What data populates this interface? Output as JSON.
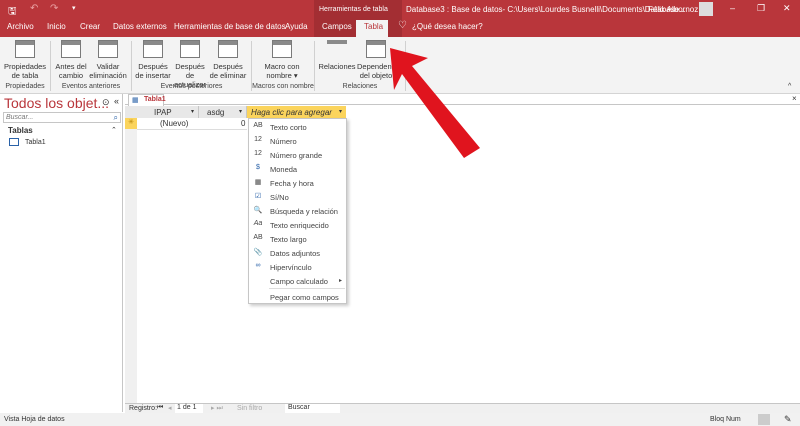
{
  "qat": {
    "save": "save-icon",
    "undo": "undo-icon",
    "redo": "redo-icon"
  },
  "title": {
    "context": "Herramientas de tabla",
    "doc": "Database3 : Base de datos- C:\\Users\\Lourdes Busnelli\\Documents\\Database...",
    "user": "Félix Albornoz"
  },
  "tabs": [
    "Archivo",
    "Inicio",
    "Crear",
    "Datos externos",
    "Herramientas de base de datos",
    "Ayuda",
    "Campos",
    "Tabla"
  ],
  "tellme": "¿Qué desea hacer?",
  "ribbon": {
    "buttons": [
      "Propiedades de tabla",
      "Antes del cambio",
      "Validar eliminación",
      "Después de insertar",
      "Después de actualizar",
      "Después de eliminar",
      "Macro con nombre ▾",
      "Relaciones",
      "Dependencias del objeto"
    ],
    "groups": [
      "Propiedades",
      "Eventos anteriores",
      "Eventos posteriores",
      "Macros con nombre",
      "Relaciones"
    ]
  },
  "nav": {
    "title": "Todos los objet...",
    "search_placeholder": "Buscar...",
    "section": "Tablas",
    "items": [
      "Tabla1"
    ]
  },
  "doc_tab": "Tabla1",
  "table": {
    "columns": [
      "IPAP",
      "asdg",
      "Haga clic para agregar"
    ],
    "new_row": "(Nuevo)",
    "new_val": "0"
  },
  "menu": [
    {
      "icon": "AB",
      "label": "Texto corto"
    },
    {
      "icon": "12",
      "label": "Número"
    },
    {
      "icon": "12",
      "label": "Número grande"
    },
    {
      "icon": "$",
      "label": "Moneda"
    },
    {
      "icon": "▦",
      "label": "Fecha y hora"
    },
    {
      "icon": "☑",
      "label": "Sí/No"
    },
    {
      "icon": "🔍",
      "label": "Búsqueda y relación"
    },
    {
      "icon": "Aa",
      "label": "Texto enriquecido"
    },
    {
      "icon": "AB",
      "label": "Texto largo"
    },
    {
      "icon": "📎",
      "label": "Datos adjuntos"
    },
    {
      "icon": "∞",
      "label": "Hipervínculo"
    },
    {
      "icon": "",
      "label": "Campo calculado"
    },
    {
      "icon": "",
      "label": "Pegar como campos"
    }
  ],
  "recnav": {
    "label": "Registro:",
    "pos": "1 de 1",
    "filter": "Sin filtro",
    "search": "Buscar"
  },
  "status": {
    "left": "Vista Hoja de datos",
    "numlock": "Bloq Num"
  },
  "colors": {
    "accent": "#b9363b",
    "arrow": "#e0141e"
  }
}
